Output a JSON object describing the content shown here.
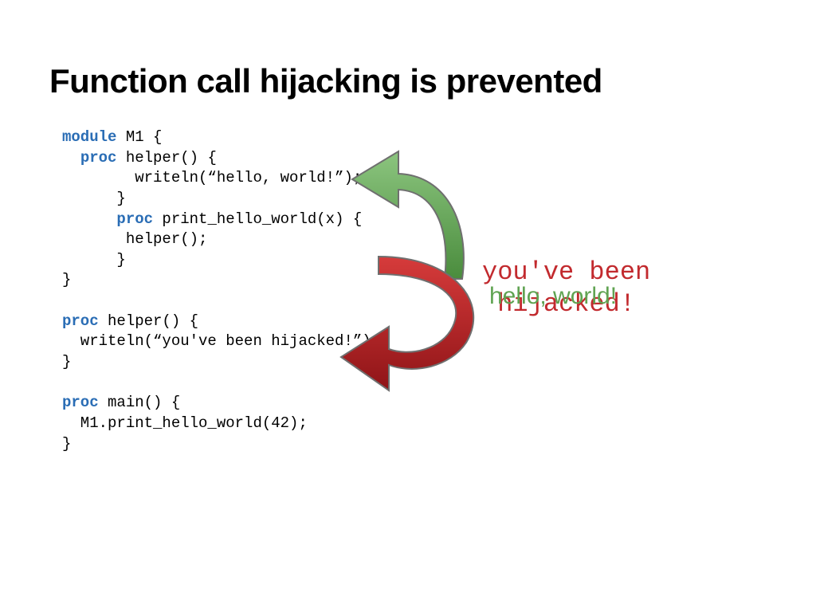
{
  "title": "Function call hijacking is prevented",
  "code": {
    "kw_module": "module",
    "m1": " M1 {",
    "indent1": "  ",
    "kw_proc1": "proc",
    "helper_decl": " helper() {",
    "indent_write1": "        writeln(“hello, world!”);",
    "indent_close1": "      }",
    "indent_proc2_pre": "      ",
    "kw_proc2": "proc",
    "print_decl": " print_hello_world(x) {",
    "indent_call": "       helper();",
    "indent_close2": "      }",
    "close_m1": "}",
    "blank": "",
    "kw_proc3": "proc",
    "helper2_decl": " helper() {",
    "write2": "  writeln(“you've been hijacked!”);",
    "close3": "}",
    "kw_proc4": "proc",
    "main_decl": " main() {",
    "main_call": "  M1.print_hello_world(42);",
    "close4": "}"
  },
  "messages": {
    "red_line1": "you've been",
    "red_line2": " hijacked!",
    "green": "hello, world!"
  },
  "colors": {
    "keyword": "#2a6db5",
    "red_msg": "#c22a2e",
    "green_msg": "#60a352",
    "arrow_green_fill": "#5b9e4d",
    "arrow_green_highlight": "#8cc57f",
    "arrow_red_fill": "#ab1b1e",
    "arrow_red_highlight": "#d63b3b",
    "arrow_stroke": "#7a7a7a"
  }
}
